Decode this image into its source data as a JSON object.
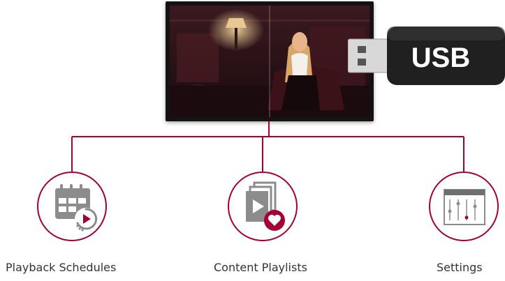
{
  "usb": {
    "label": "USB"
  },
  "features": [
    {
      "id": "playback-schedules",
      "label": "Playback Schedules",
      "icon": "calendar-play-icon"
    },
    {
      "id": "content-playlists",
      "label": "Content Playlists",
      "icon": "playlist-heart-icon"
    },
    {
      "id": "settings",
      "label": "Settings",
      "icon": "sliders-icon"
    }
  ],
  "colors": {
    "accent": "#a50034",
    "icon_gray": "#8c8c8c",
    "text": "#333333"
  }
}
